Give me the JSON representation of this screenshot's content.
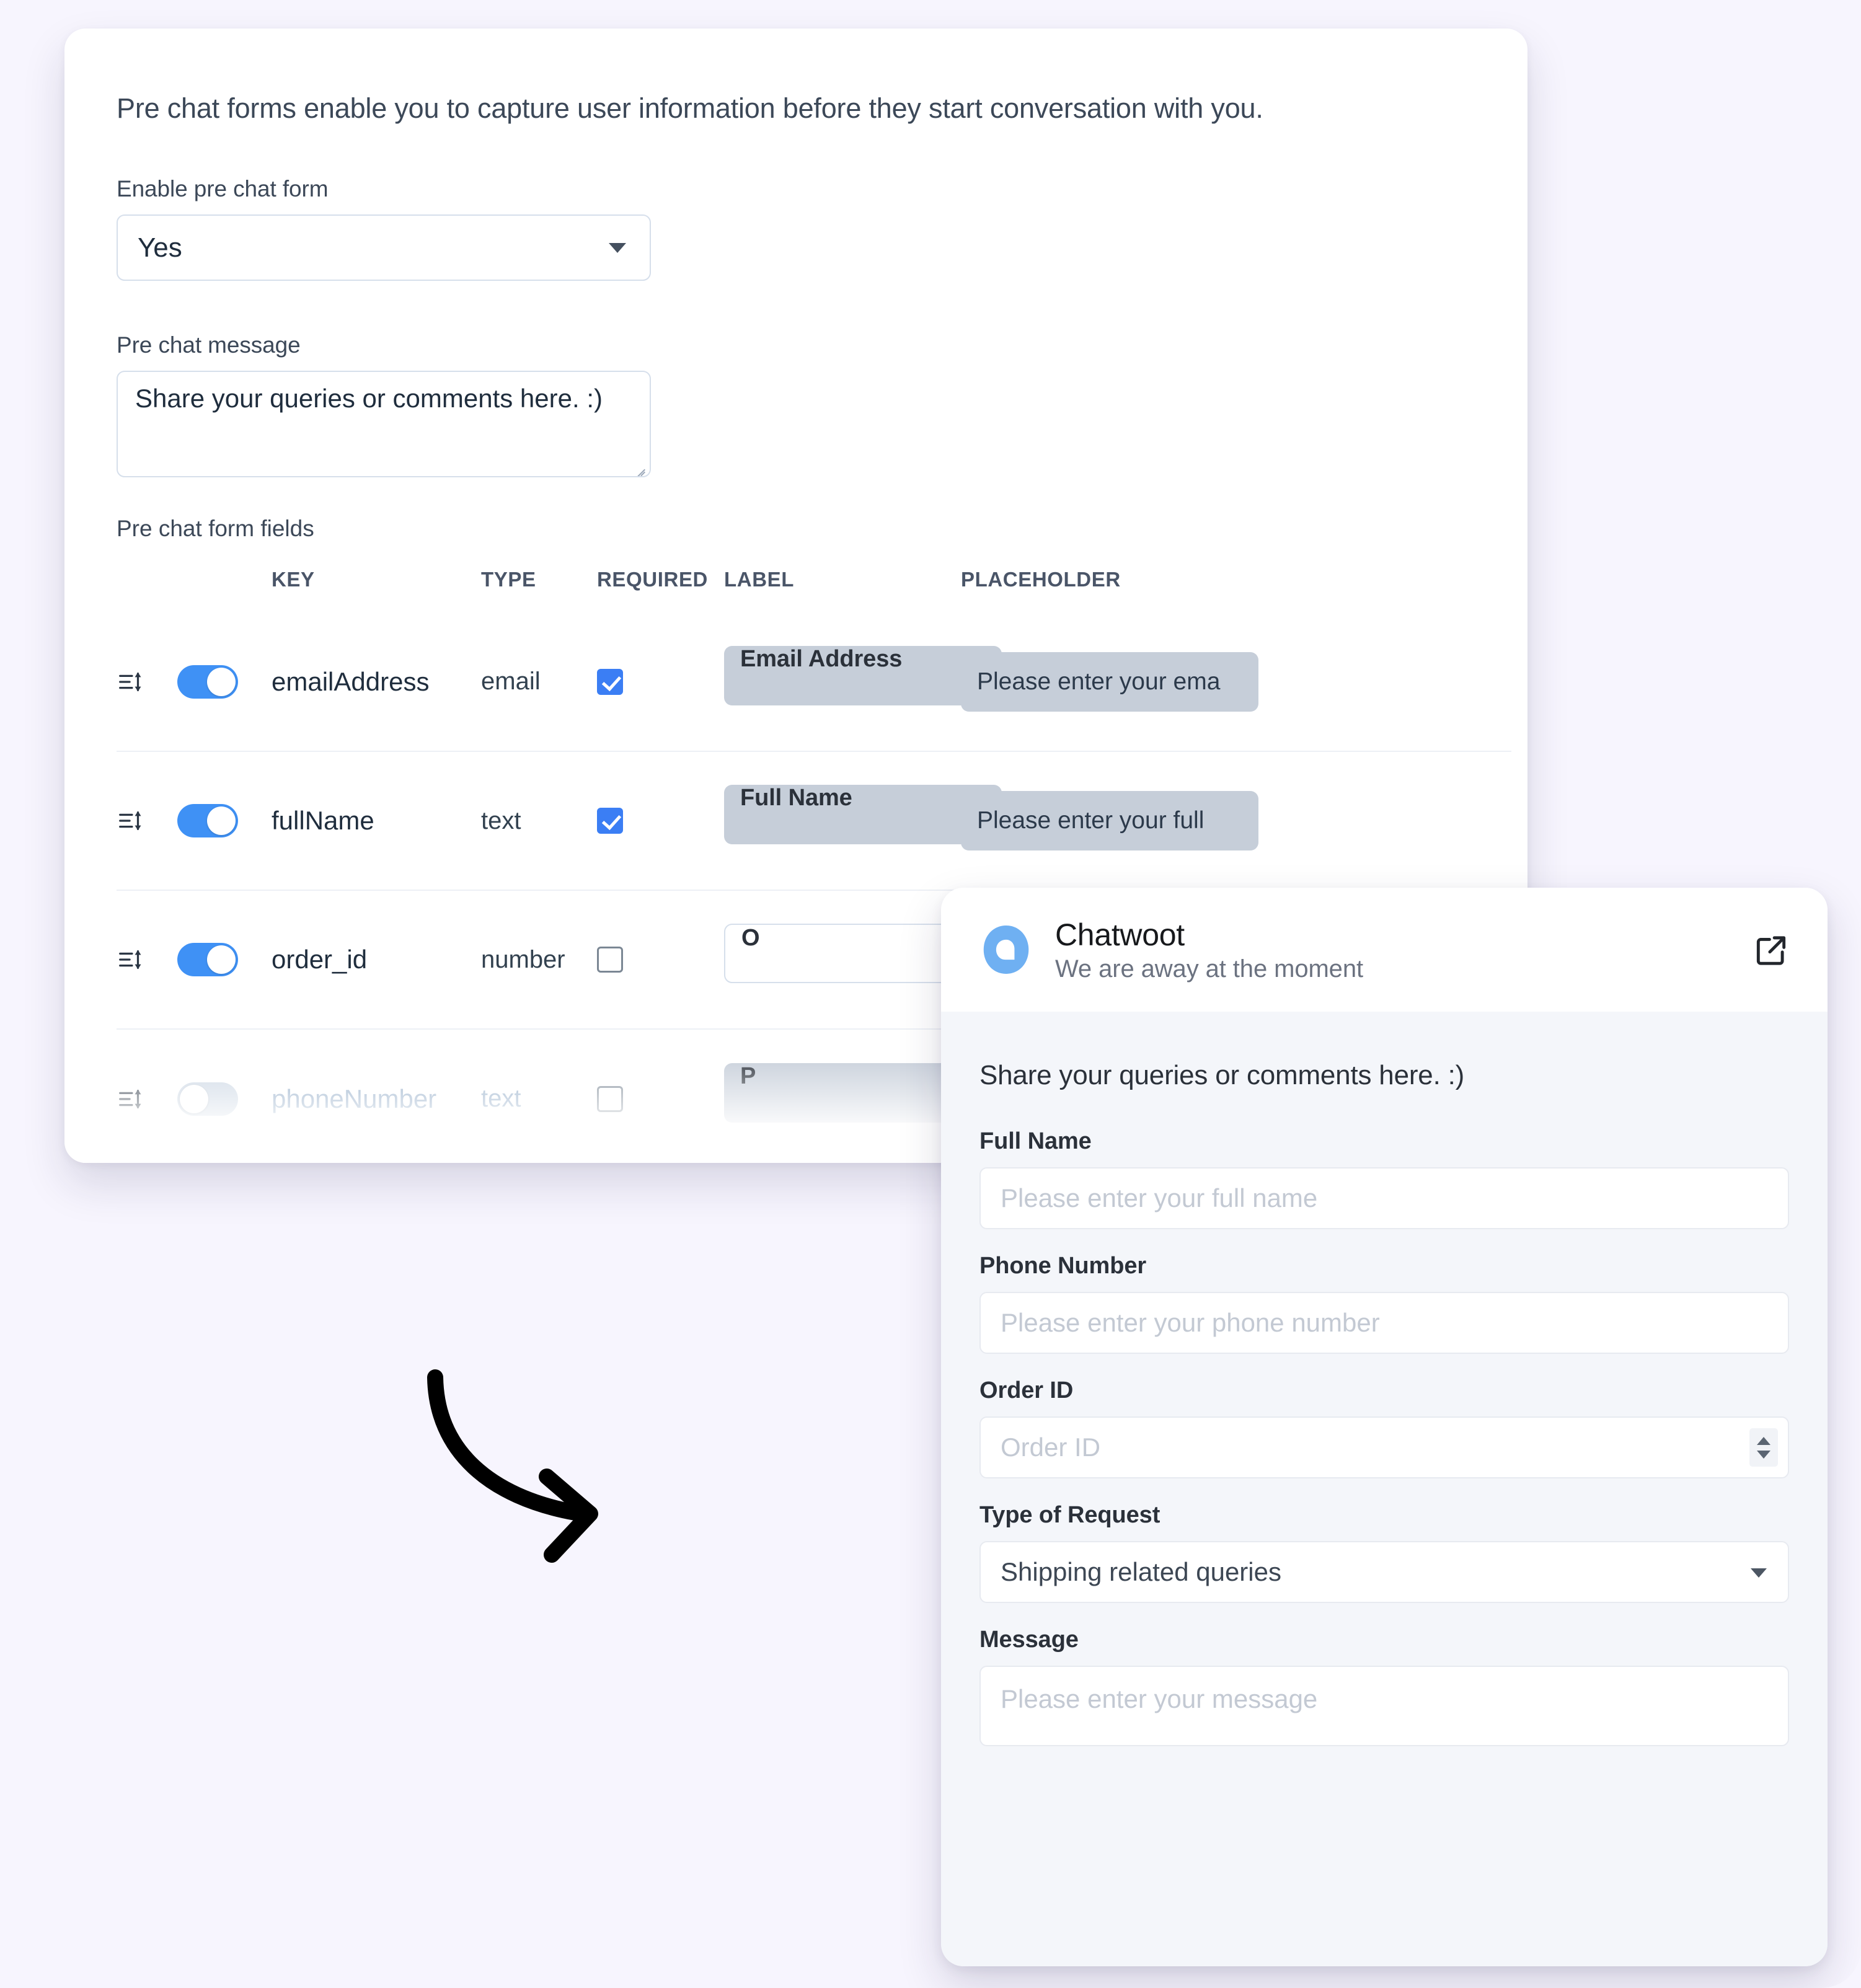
{
  "settings": {
    "intro": "Pre chat forms enable you to capture user information before they start conversation with you.",
    "enable_label": "Enable pre chat form",
    "enable_value": "Yes",
    "message_label": "Pre chat message",
    "message_value": "Share your queries or comments here. :)",
    "fields_label": "Pre chat form fields",
    "columns": [
      "KEY",
      "TYPE",
      "REQUIRED",
      "LABEL",
      "PLACEHOLDER"
    ],
    "rows": [
      {
        "key": "emailAddress",
        "type": "email",
        "enabled": true,
        "required": true,
        "label": "Email Address",
        "placeholder": "Please enter your ema"
      },
      {
        "key": "fullName",
        "type": "text",
        "enabled": true,
        "required": true,
        "label": "Full Name",
        "placeholder": "Please enter your full"
      },
      {
        "key": "order_id",
        "type": "number",
        "enabled": true,
        "required": false,
        "label": "O",
        "placeholder": ""
      },
      {
        "key": "phoneNumber",
        "type": "text",
        "enabled": false,
        "required": false,
        "label": "P",
        "placeholder": ""
      }
    ]
  },
  "widget": {
    "brand_name": "Chatwoot",
    "status": "We are away at the moment",
    "intro": "Share your queries or comments here. :)",
    "fields": [
      {
        "label": "Full Name",
        "placeholder": "Please enter your full name"
      },
      {
        "label": "Phone Number",
        "placeholder": "Please enter your phone number"
      },
      {
        "label": "Order ID",
        "placeholder": "Order ID"
      },
      {
        "label": "Type of Request",
        "value": "Shipping related queries"
      },
      {
        "label": "Message",
        "placeholder": "Please enter your message"
      }
    ]
  },
  "colors": {
    "accent_blue": "#3f91f5",
    "checkbox_blue": "#3b7ef4",
    "page_background": "#f7f5fe",
    "widget_background": "#f4f6fa",
    "brand_logo": "#6fb0f2"
  }
}
